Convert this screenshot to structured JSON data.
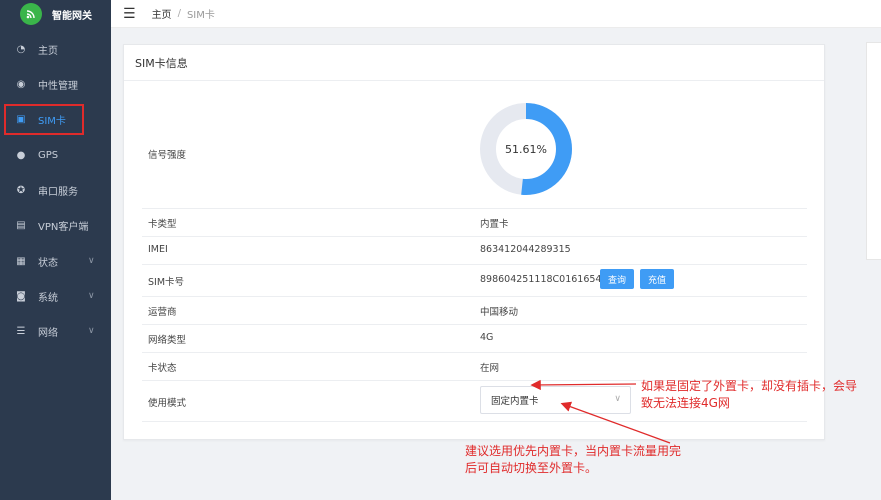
{
  "sidebar": {
    "brand": "智能网关",
    "items": [
      {
        "label": "主页",
        "icon": "dashboard-icon"
      },
      {
        "label": "中性管理",
        "icon": "eye-icon"
      },
      {
        "label": "SIM卡",
        "icon": "sim-card-icon"
      },
      {
        "label": "GPS",
        "icon": "globe-icon"
      },
      {
        "label": "串口服务",
        "icon": "serial-port-icon"
      },
      {
        "label": "VPN客户端",
        "icon": "vpn-icon"
      },
      {
        "label": "状态",
        "icon": "grid-icon"
      },
      {
        "label": "系统",
        "icon": "system-icon"
      },
      {
        "label": "网络",
        "icon": "network-icon"
      }
    ]
  },
  "breadcrumb": {
    "home": "主页",
    "sep": "/",
    "current": "SIM卡"
  },
  "card": {
    "title": "SIM卡信息",
    "signal_label": "信号强度",
    "signal_value": "51.61%",
    "signal_fraction": 0.5161,
    "rows": [
      {
        "label": "卡类型",
        "value": "内置卡"
      },
      {
        "label": "IMEI",
        "value": "863412044289315"
      },
      {
        "label": "SIM卡号",
        "value": "898604251118C0161654"
      },
      {
        "label": "运营商",
        "value": "中国移动"
      },
      {
        "label": "网络类型",
        "value": "4G"
      },
      {
        "label": "卡状态",
        "value": "在网"
      }
    ],
    "query_button": "查询",
    "recharge_button": "充值",
    "mode_label": "使用模式",
    "mode_value": "固定内置卡"
  },
  "notes": {
    "note1_line1": "如果是固定了外置卡，却没有插卡，会导",
    "note1_line2": "致无法连接4G网",
    "note2_line1": "建议选用优先内置卡，当内置卡流量用完",
    "note2_line2": "后可自动切换至外置卡。"
  },
  "colors": {
    "accent": "#3f9cf5",
    "sidebar": "#2c3a4e",
    "annotation": "#e02b2b"
  }
}
